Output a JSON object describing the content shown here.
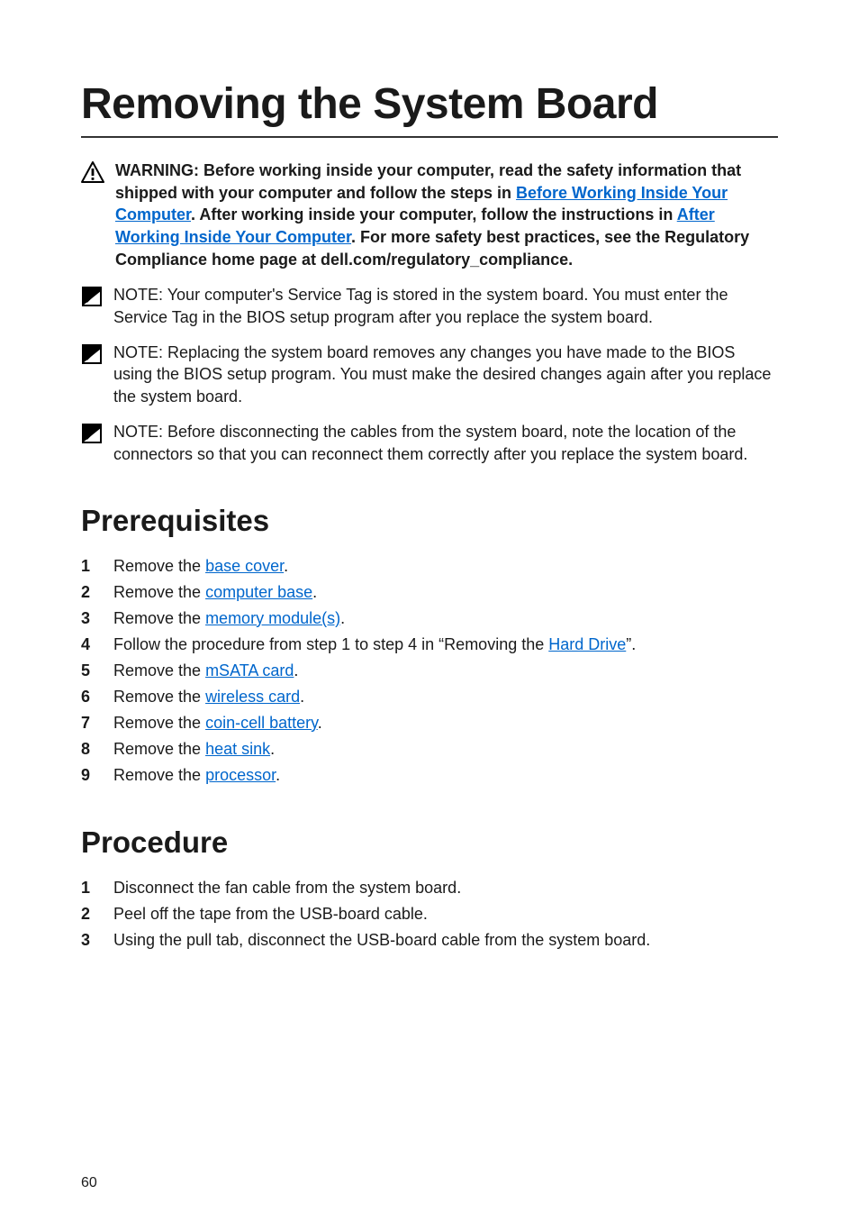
{
  "title": "Removing the System Board",
  "warning": {
    "prefix": "WARNING: Before working inside your computer, read the safety information that shipped with your computer and follow the steps in ",
    "link1": "Before Working Inside Your Computer",
    "mid1": ". After working inside your computer, follow the instructions in ",
    "link2": "After Working Inside Your Computer",
    "suffix": ". For more safety best practices, see the Regulatory Compliance home page at dell.com/regulatory_compliance."
  },
  "notes": {
    "n1": {
      "label": "NOTE: ",
      "text": "Your computer's Service Tag is stored in the system board. You must enter the Service Tag in the BIOS setup program after you replace the system board."
    },
    "n2": {
      "label": "NOTE: ",
      "text": "Replacing the system board removes any changes you have made to the BIOS using the BIOS setup program. You must make the desired changes again after you replace the system board."
    },
    "n3": {
      "label": "NOTE: ",
      "text": "Before disconnecting the cables from the system board, note the location of the connectors so that you can reconnect them correctly after you replace the system board."
    }
  },
  "sections": {
    "prereq": "Prerequisites",
    "proc": "Procedure"
  },
  "prereq": {
    "i1_a": "Remove the ",
    "i1_l": "base cover",
    "i1_b": ".",
    "i2_a": "Remove the ",
    "i2_l": "computer base",
    "i2_b": ".",
    "i3_a": "Remove the ",
    "i3_l": "memory module(s)",
    "i3_b": ".",
    "i4_a": "Follow the procedure from step 1 to step 4 in “Removing the ",
    "i4_l": "Hard Drive",
    "i4_b": "”.",
    "i5_a": "Remove the ",
    "i5_l": "mSATA card",
    "i5_b": ".",
    "i6_a": "Remove the ",
    "i6_l": "wireless card",
    "i6_b": ".",
    "i7_a": "Remove the ",
    "i7_l": "coin-cell battery",
    "i7_b": ".",
    "i8_a": "Remove the ",
    "i8_l": "heat sink",
    "i8_b": ".",
    "i9_a": "Remove the ",
    "i9_l": "processor",
    "i9_b": "."
  },
  "proc": {
    "p1": "Disconnect the fan cable from the system board.",
    "p2": "Peel off the tape from the USB-board cable.",
    "p3": "Using the pull tab, disconnect the USB-board cable from the system board."
  },
  "page_number": "60"
}
